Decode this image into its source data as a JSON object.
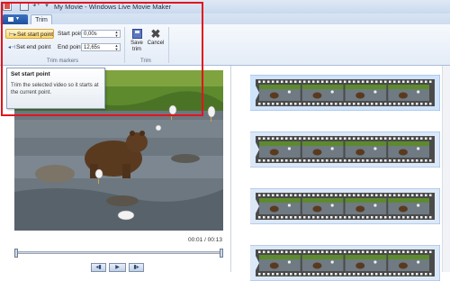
{
  "window": {
    "title": "My Movie - Windows Live Movie Maker"
  },
  "ribbon": {
    "tabs": [
      {
        "label": "Trim"
      }
    ],
    "trim_markers": {
      "set_start_point_label": "Set start point",
      "set_end_point_label": "Set end point",
      "start_point_label": "Start point:",
      "start_point_value": "0,00s",
      "end_point_label": "End point:",
      "end_point_value": "12,65s",
      "group_label": "Trim markers"
    },
    "trim": {
      "save_trim_label": "Save\ntrim",
      "cancel_label": "Cancel",
      "group_label": "Trim"
    }
  },
  "tooltip": {
    "title": "Set start point",
    "body": "Trim the selected video so it starts at the current point."
  },
  "preview": {
    "playback_time": "00:01 / 00:13",
    "trim_start_fraction": 0.0,
    "trim_end_fraction": 1.0
  },
  "storyboard": {
    "clip_count": 4,
    "selected_clip_index": 0
  },
  "colors": {
    "highlight": "#e2141d",
    "selection": "#cfe3fb",
    "ribbon_blue": "#2d5fae"
  }
}
